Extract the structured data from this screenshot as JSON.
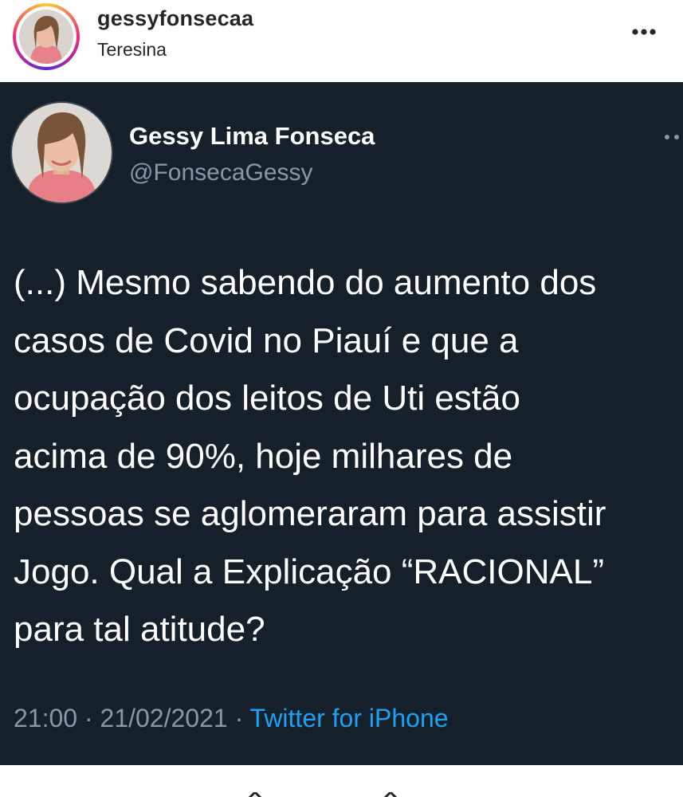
{
  "post": {
    "username": "gessyfonsecaa",
    "location": "Teresina",
    "avatar_icon": "profile-photo",
    "more_icon": "more-horizontal-icon"
  },
  "tweet": {
    "display_name": "Gessy Lima Fonseca",
    "handle": "@FonsecaGessy",
    "lines": [
      "(...) Mesmo sabendo do aumento dos",
      "casos de Covid no Piauí e que a",
      "ocupação dos leitos de Uti estão",
      "acima de 90%, hoje milhares de",
      "pessoas se aglomeraram para assistir",
      "Jogo. Qual a Explicação “RACIONAL”",
      "para tal atitude?"
    ],
    "time": "21:00",
    "separator": "·",
    "date": "21/02/2021",
    "source": "Twitter for iPhone"
  },
  "colors": {
    "tweet_background": "#15202b",
    "tweet_text": "#ffffff",
    "secondary_text": "#8899a6",
    "link": "#1da1f2"
  }
}
